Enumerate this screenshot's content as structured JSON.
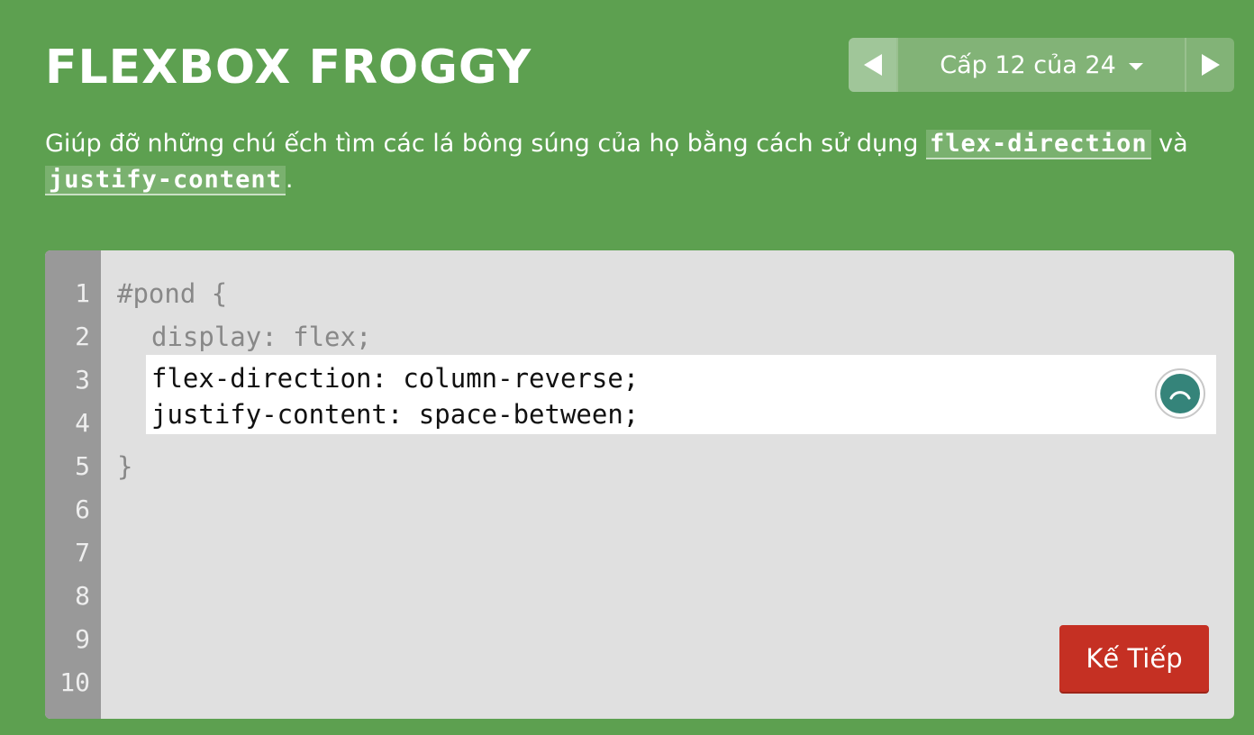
{
  "header": {
    "title": "FLEXBOX FROGGY"
  },
  "level_nav": {
    "level_text": "Cấp 12 của 24",
    "prev_icon": "arrow-left-icon",
    "next_icon": "arrow-right-icon",
    "dropdown_icon": "caret-down-icon"
  },
  "instructions": {
    "text_before": "Giúp đỡ những chú ếch tìm các lá bông súng của họ bằng cách sử dụng ",
    "keyword_1": "flex-direction",
    "text_between": " và ",
    "keyword_2": "justify-content",
    "text_after": "."
  },
  "editor": {
    "line_numbers": [
      "1",
      "2",
      "3",
      "4",
      "5",
      "6",
      "7",
      "8",
      "9",
      "10"
    ],
    "line_1": "#pond {",
    "line_2": "display: flex;",
    "answer": "flex-direction: column-reverse;\njustify-content: space-between;",
    "line_5": "}",
    "loading_icon": "loading-spinner-icon"
  },
  "next_button": {
    "label": "Kế Tiếp"
  },
  "colors": {
    "background": "#5da050",
    "editor_bg": "#e0e0e0",
    "gutter_bg": "#999999",
    "button_red": "#c53023",
    "spinner_teal": "#35847a"
  }
}
